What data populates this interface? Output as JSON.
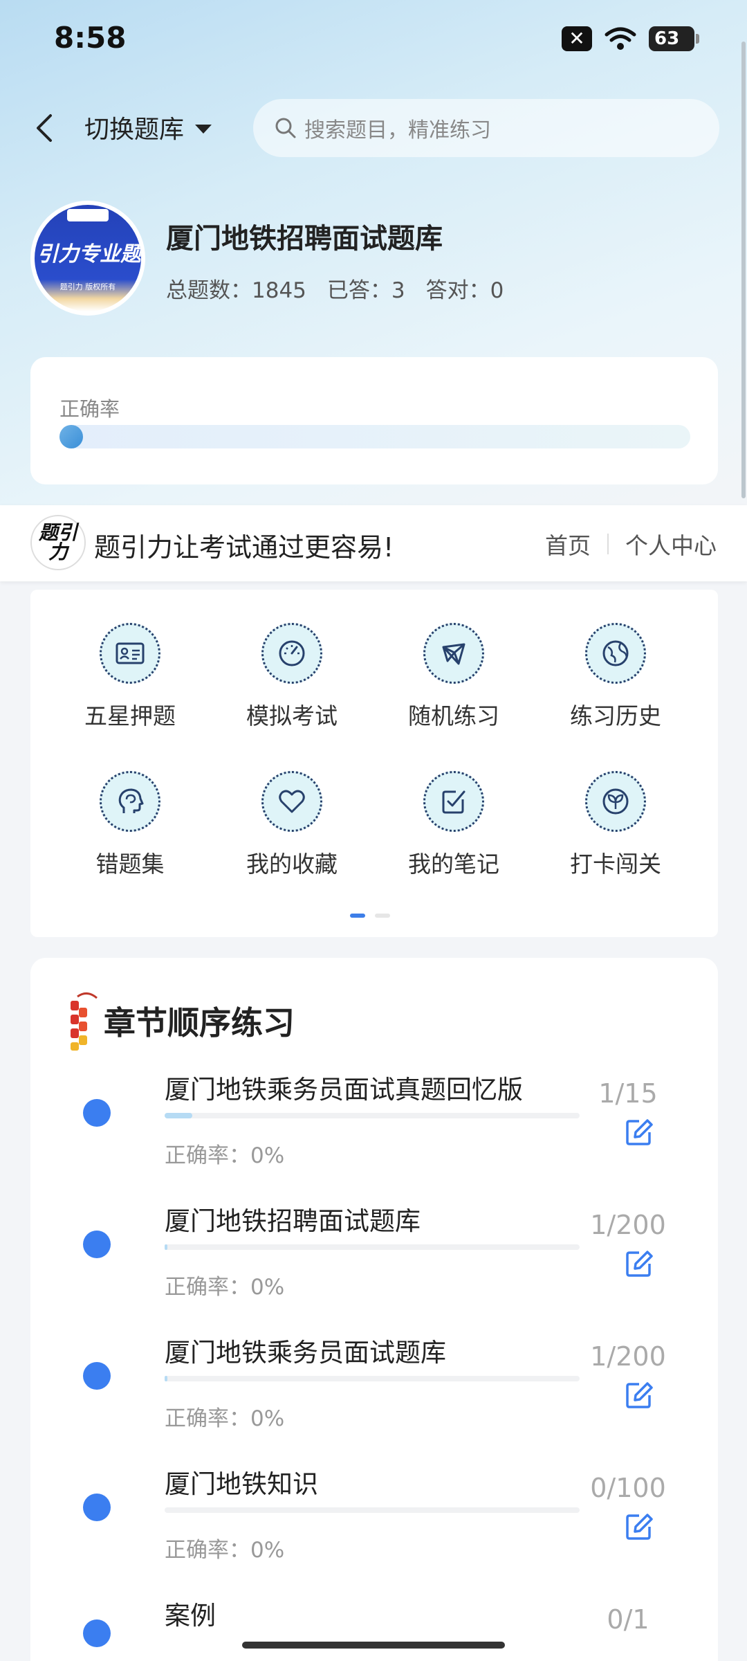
{
  "status": {
    "time": "8:58",
    "battery": "63"
  },
  "nav": {
    "switch_label": "切换题库",
    "search_placeholder": "搜索题目，精准练习"
  },
  "bank": {
    "logo_text": "引力专业题",
    "logo_sub": "题引力 版权所有",
    "title": "厦门地铁招聘面试题库",
    "total_label": "总题数：1845",
    "answered_label": "已答：3",
    "correct_label": "答对：0"
  },
  "accuracy": {
    "label": "正确率",
    "value": 0
  },
  "promo": {
    "logo": "题引力",
    "text": "题引力让考试通过更容易!",
    "home": "首页",
    "personal": "个人中心"
  },
  "grid": {
    "items": [
      {
        "label": "五星押题",
        "icon": "id-card-icon"
      },
      {
        "label": "模拟考试",
        "icon": "speedometer-icon"
      },
      {
        "label": "随机练习",
        "icon": "network-icon"
      },
      {
        "label": "练习历史",
        "icon": "globe-icon"
      },
      {
        "label": "错题集",
        "icon": "head-brain-icon"
      },
      {
        "label": "我的收藏",
        "icon": "heart-icon"
      },
      {
        "label": "我的笔记",
        "icon": "note-check-icon"
      },
      {
        "label": "打卡闯关",
        "icon": "sprout-icon"
      }
    ],
    "page": 1,
    "pages": 2
  },
  "chapters": {
    "heading": "章节顺序练习",
    "items": [
      {
        "title": "厦门地铁乘务员面试真题回忆版",
        "accuracy": "正确率：0%",
        "count": "1/15",
        "progress": 0.0667
      },
      {
        "title": "厦门地铁招聘面试题库",
        "accuracy": "正确率：0%",
        "count": "1/200",
        "progress": 0.005
      },
      {
        "title": "厦门地铁乘务员面试题库",
        "accuracy": "正确率：0%",
        "count": "1/200",
        "progress": 0.005
      },
      {
        "title": "厦门地铁知识",
        "accuracy": "正确率：0%",
        "count": "0/100",
        "progress": 0
      },
      {
        "title": "案例",
        "accuracy": "",
        "count": "0/1",
        "progress": 0
      }
    ]
  },
  "colors": {
    "accent": "#3b7ef0",
    "icon_bg": "#dff4f8",
    "icon_stroke": "#27416c"
  }
}
